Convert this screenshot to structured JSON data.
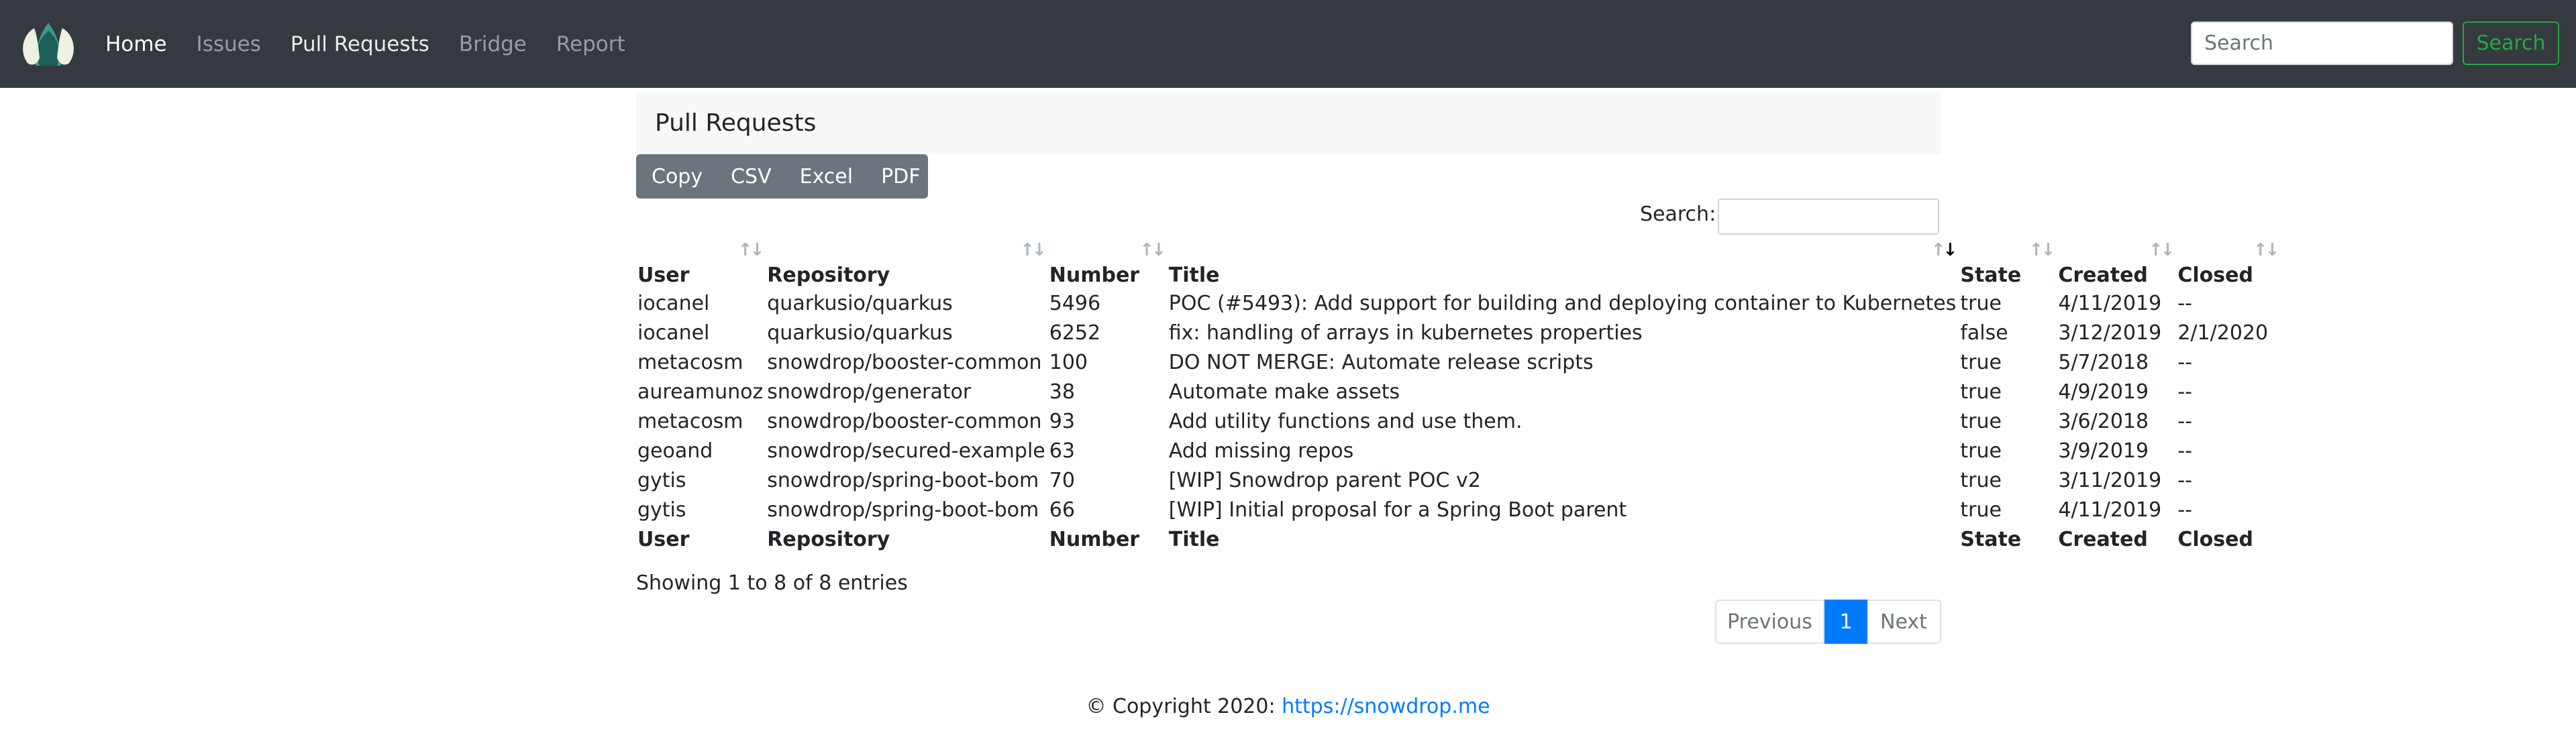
{
  "nav": {
    "links": [
      "Home",
      "Issues",
      "Pull Requests",
      "Bridge",
      "Report"
    ],
    "search_placeholder": "Search",
    "search_button": "Search"
  },
  "page": {
    "title": "Pull Requests"
  },
  "export_buttons": [
    "Copy",
    "CSV",
    "Excel",
    "PDF"
  ],
  "table_search": {
    "label": "Search:",
    "value": ""
  },
  "table": {
    "columns": [
      "User",
      "Repository",
      "Number",
      "Title",
      "State",
      "Created",
      "Closed"
    ],
    "sorted_column": "Title",
    "rows": [
      [
        "iocanel",
        "quarkusio/quarkus",
        "5496",
        "POC (#5493): Add support for building and deploying container to Kubernetes",
        "true",
        "4/11/2019",
        "--"
      ],
      [
        "iocanel",
        "quarkusio/quarkus",
        "6252",
        "fix: handling of arrays in kubernetes properties",
        "false",
        "3/12/2019",
        "2/1/2020"
      ],
      [
        "metacosm",
        "snowdrop/booster-common",
        "100",
        "DO NOT MERGE: Automate release scripts",
        "true",
        "5/7/2018",
        "--"
      ],
      [
        "aureamunoz",
        "snowdrop/generator",
        "38",
        "Automate make assets",
        "true",
        "4/9/2019",
        "--"
      ],
      [
        "metacosm",
        "snowdrop/booster-common",
        "93",
        "Add utility functions and use them.",
        "true",
        "3/6/2018",
        "--"
      ],
      [
        "geoand",
        "snowdrop/secured-example",
        "63",
        "Add missing repos",
        "true",
        "3/9/2019",
        "--"
      ],
      [
        "gytis",
        "snowdrop/spring-boot-bom",
        "70",
        "[WIP] Snowdrop parent POC v2",
        "true",
        "3/11/2019",
        "--"
      ],
      [
        "gytis",
        "snowdrop/spring-boot-bom",
        "66",
        "[WIP] Initial proposal for a Spring Boot parent",
        "true",
        "4/11/2019",
        "--"
      ]
    ]
  },
  "info": "Showing 1 to 8 of 8 entries",
  "pagination": {
    "previous": "Previous",
    "current": "1",
    "next": "Next"
  },
  "footer": {
    "text": "© Copyright 2020: ",
    "link": "https://snowdrop.me"
  },
  "colors": {
    "navbar": "#343a40",
    "success": "#28a745",
    "primary": "#007bff",
    "secondary": "#6c757d"
  }
}
